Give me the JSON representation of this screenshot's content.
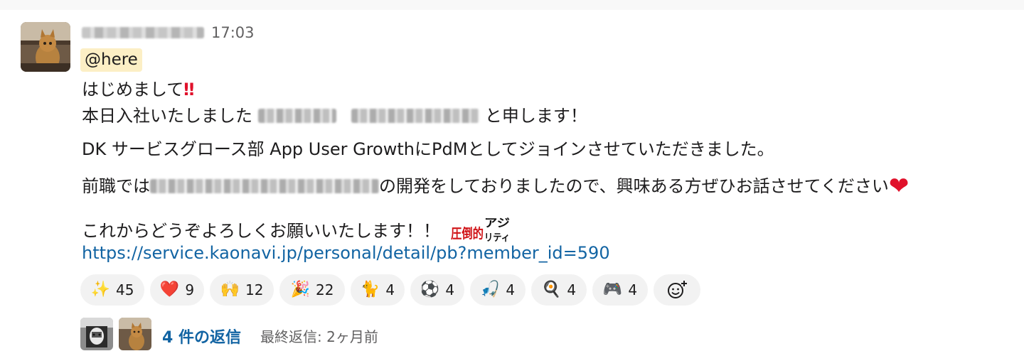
{
  "message": {
    "time": "17:03",
    "mention": "@here",
    "line1": "はじめまして",
    "line1_emoji": "‼",
    "line2_prefix": "本日入社いたしました",
    "line2_suffix": "と申します！",
    "line3": "DK サービスグロース部 App User GrowthにPdMとしてジョインさせていただきました。",
    "line4_prefix": "前職では",
    "line4_suffix": "の開発をしておりましたので、興味ある方ぜひお話させてください",
    "line4_emoji": "❤",
    "line5": "これからどうぞよろしくお願いいたします！！",
    "stamp_main": "圧倒的",
    "stamp_top": "アジ",
    "stamp_bottom": "リティ",
    "link": "https://service.kaonavi.jp/personal/detail/pb?member_id=590"
  },
  "reactions": [
    {
      "icon": "sparkles-icon",
      "emoji": "✨",
      "count": "45"
    },
    {
      "icon": "heart-icon",
      "emoji": "❤️",
      "count": "9"
    },
    {
      "icon": "raised-hands-icon",
      "emoji": "🙌",
      "count": "12"
    },
    {
      "icon": "party-popper-icon",
      "emoji": "🎉",
      "count": "22"
    },
    {
      "icon": "cat-icon",
      "emoji": "🐈",
      "count": "4"
    },
    {
      "icon": "soccer-ball-icon",
      "emoji": "⚽",
      "count": "4"
    },
    {
      "icon": "fishing-icon",
      "emoji": "🎣",
      "count": "4"
    },
    {
      "icon": "frying-pan-icon",
      "emoji": "🍳",
      "count": "4"
    },
    {
      "icon": "game-controller-icon",
      "emoji": "🎮",
      "count": "4"
    }
  ],
  "thread": {
    "replies": "4 件の返信",
    "last_reply": "最終返信: 2ヶ月前"
  },
  "colors": {
    "link": "#1264a3",
    "mention_bg": "#fcefc5",
    "reaction_bg": "#f2f2f2",
    "emphasis": "#e0112b"
  }
}
